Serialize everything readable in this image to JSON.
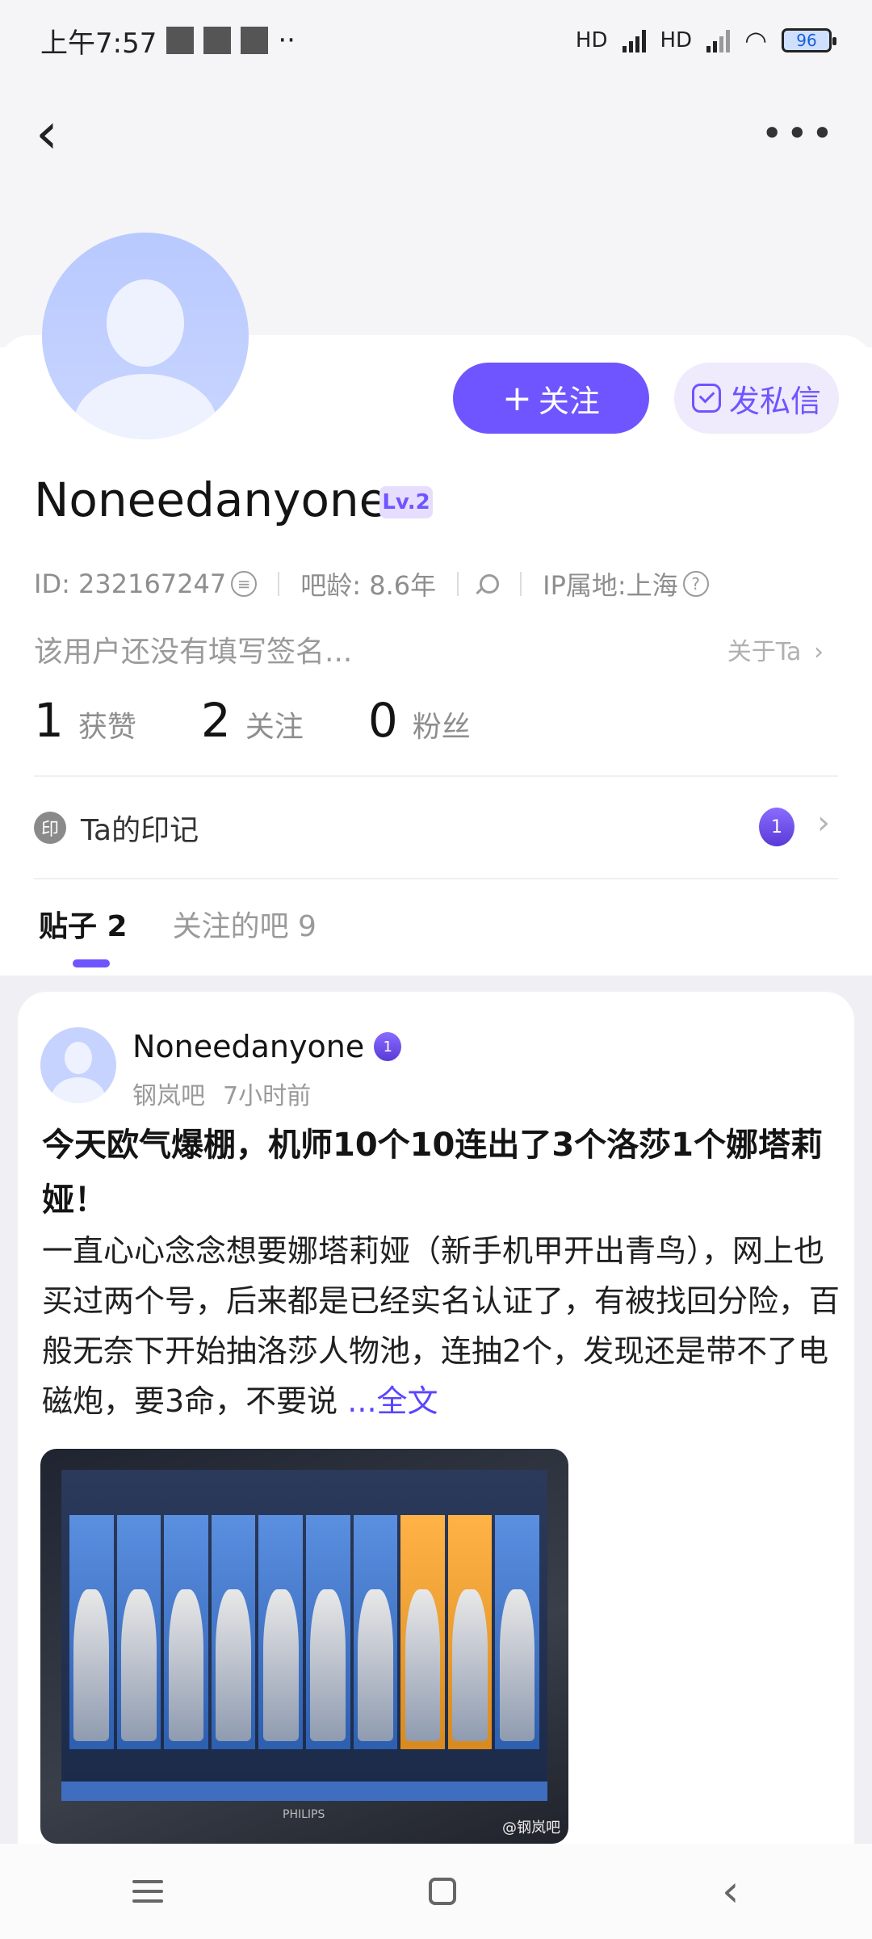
{
  "status_bar": {
    "time": "上午7:57",
    "dots": "··",
    "hd1": "HD",
    "hd2": "HD",
    "battery": "96"
  },
  "profile": {
    "username": "Noneedanyone",
    "level": "Lv.2",
    "id": "ID: 232167247",
    "bar_age": "吧龄: 8.6年",
    "ip": "IP属地:上海",
    "signature": "该用户还没有填写签名...",
    "about": "关于Ta",
    "follow_button": "关注",
    "message_button": "发私信"
  },
  "stats": [
    {
      "num": "1",
      "label": "获赞"
    },
    {
      "num": "2",
      "label": "关注"
    },
    {
      "num": "0",
      "label": "粉丝"
    }
  ],
  "marks": {
    "label": "Ta的印记",
    "prefix": "印",
    "badge": "1"
  },
  "tabs": [
    {
      "label": "贴子 2"
    },
    {
      "label": "关注的吧 9"
    }
  ],
  "post": {
    "user": "Noneedanyone",
    "forum": "钢岚吧",
    "time": "7小时前",
    "title": "今天欧气爆棚，机师10个10连出了3个洛莎1个娜塔莉娅！",
    "body": "一直心心念念想要娜塔莉娅（新手机甲开出青鸟），网上也买过两个号，后来都是已经实名认证了，有被找回分险，百般无奈下开始抽洛莎人物池，连抽2个，发现还是带不了电磁炮，要3命，不要说",
    "more": "...全文",
    "watermark": "@钢岚吧",
    "brand": "PHILIPS"
  },
  "colors": {
    "accent": "#6e55ff",
    "link": "#5a45ff"
  }
}
